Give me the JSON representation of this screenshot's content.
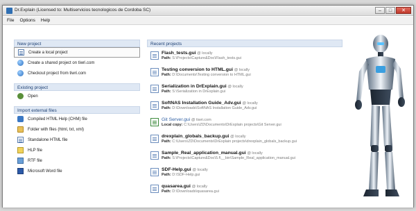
{
  "window": {
    "title": "Dr.Explain (Licensed to: Multiservicios tecnologicos de Cordoba SC)",
    "controls": {
      "minimize": "–",
      "maximize": "□",
      "close": "✕"
    }
  },
  "menu": [
    "File",
    "Options",
    "Help"
  ],
  "left": {
    "new_project": {
      "header": "New project",
      "items": [
        {
          "label": "Create a local project",
          "icon": "document-icon",
          "selected": true
        },
        {
          "label": "Create a shared project on tiwri.com",
          "icon": "globe-icon",
          "selected": false
        },
        {
          "label": "Checkout project from tiwri.com",
          "icon": "globe-icon",
          "selected": false
        }
      ]
    },
    "existing_project": {
      "header": "Existing project",
      "items": [
        {
          "label": "Open",
          "icon": "open-icon"
        }
      ]
    },
    "import": {
      "header": "Import external files",
      "items": [
        {
          "label": "Compiled HTML Help (CHM) file",
          "icon": "chm-help-icon"
        },
        {
          "label": "Folder with files (html, txt, xml)",
          "icon": "folder-icon"
        },
        {
          "label": "Standalone HTML file",
          "icon": "html-file-icon"
        },
        {
          "label": "HLP file",
          "icon": "hlp-file-icon"
        },
        {
          "label": "RTF file",
          "icon": "rtf-file-icon"
        },
        {
          "label": "Microsoft Word file",
          "icon": "word-file-icon"
        }
      ]
    }
  },
  "recent": {
    "header": "Recent projects",
    "items": [
      {
        "name": "Flash_tests.gui",
        "location": "@ locally",
        "key": "Path:",
        "path": "S:\\Projects\\Capture&Doc\\Flash_tests.gui",
        "link": false
      },
      {
        "name": "Testing conversion to HTML.gui",
        "location": "@ locally",
        "key": "Path:",
        "path": "D:\\Documents\\Testing conversion to HTML.gui",
        "link": false
      },
      {
        "name": "Serialization in DrExplain.gui",
        "location": "@ locally",
        "key": "Path:",
        "path": "S:\\Serialization in DrExplain.gui",
        "link": false
      },
      {
        "name": "SoftNAS Installation Guide_Adv.gui",
        "location": "@ locally",
        "key": "Path:",
        "path": "D:\\Downloads\\SoftNAS Installation Guide_Adv.gui",
        "link": false
      },
      {
        "name": "Git Server.gui",
        "location": "@ tiwri.com",
        "key": "Local copy:",
        "path": "C:\\Users\\ZD\\Documents\\DrExplain projects\\Git Server.gui",
        "link": true
      },
      {
        "name": "drexplain_globals_backup.gui",
        "location": "@ locally",
        "key": "Path:",
        "path": "C:\\Users\\ZD\\Documents\\DrExplain projects\\drexplain_globals_backup.gui",
        "link": false
      },
      {
        "name": "Sample_Real_application_manual.gui",
        "location": "@ locally",
        "key": "Path:",
        "path": "S:\\Projects\\Capture&Doc\\5.f\\__bin\\Sample_Real_application_manual.gui",
        "link": false
      },
      {
        "name": "SDF-Help.gui",
        "location": "@ locally",
        "key": "Path:",
        "path": "D:\\SDF-Help.gui",
        "link": false
      },
      {
        "name": "quasarea.gui",
        "location": "@ locally",
        "key": "Path:",
        "path": "D:\\Downloads\\quasarea.gui",
        "link": false
      }
    ]
  },
  "colors": {
    "section_header_bg": "#dfe8f4",
    "section_header_text": "#1c3f73",
    "link_blue": "#2f5fa3",
    "path_gray": "#7a7a7a"
  }
}
